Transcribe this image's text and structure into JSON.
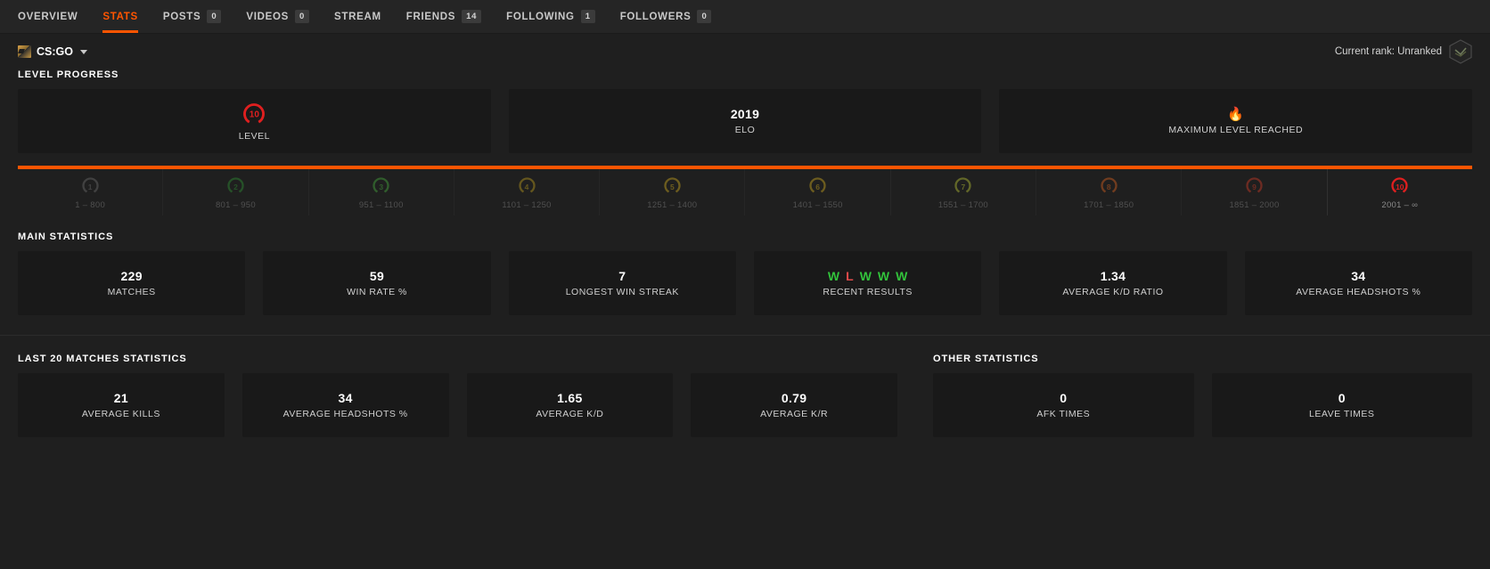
{
  "nav": {
    "items": [
      {
        "label": "OVERVIEW",
        "badge": null,
        "active": false
      },
      {
        "label": "STATS",
        "badge": null,
        "active": true
      },
      {
        "label": "POSTS",
        "badge": "0",
        "active": false
      },
      {
        "label": "VIDEOS",
        "badge": "0",
        "active": false
      },
      {
        "label": "STREAM",
        "badge": null,
        "active": false
      },
      {
        "label": "FRIENDS",
        "badge": "14",
        "active": false
      },
      {
        "label": "FOLLOWING",
        "badge": "1",
        "active": false
      },
      {
        "label": "FOLLOWERS",
        "badge": "0",
        "active": false
      }
    ]
  },
  "gamebar": {
    "game": "CS:GO",
    "rank_text": "Current rank: Unranked"
  },
  "level_progress": {
    "title": "LEVEL PROGRESS",
    "cards": [
      {
        "value": "10",
        "label": "LEVEL",
        "kind": "level-badge"
      },
      {
        "value": "2019",
        "label": "ELO",
        "kind": "text"
      },
      {
        "value": "🔥",
        "label": "MAXIMUM LEVEL REACHED",
        "kind": "flame"
      }
    ],
    "progress_percent": 100,
    "ticks": [
      {
        "level": "1",
        "range": "1 – 800",
        "color": "#6b6b6b",
        "dim": true
      },
      {
        "level": "2",
        "range": "801 – 950",
        "color": "#2f8f34",
        "dim": true
      },
      {
        "level": "3",
        "range": "951 – 1100",
        "color": "#46a83c",
        "dim": true
      },
      {
        "level": "4",
        "range": "1101 – 1250",
        "color": "#b99a1d",
        "dim": true
      },
      {
        "level": "5",
        "range": "1251 – 1400",
        "color": "#c9a61f",
        "dim": true
      },
      {
        "level": "6",
        "range": "1401 – 1550",
        "color": "#c9a61f",
        "dim": true
      },
      {
        "level": "7",
        "range": "1551 – 1700",
        "color": "#b5bf33",
        "dim": true
      },
      {
        "level": "8",
        "range": "1701 – 1850",
        "color": "#d4611f",
        "dim": true
      },
      {
        "level": "9",
        "range": "1851 – 2000",
        "color": "#cc3b26",
        "dim": true
      },
      {
        "level": "10",
        "range": "2001 – ∞",
        "color": "#e01f1f",
        "dim": false
      }
    ]
  },
  "main_statistics": {
    "title": "MAIN STATISTICS",
    "cards": [
      {
        "value": "229",
        "label": "MATCHES",
        "kind": "text"
      },
      {
        "value": "59",
        "label": "WIN RATE %",
        "kind": "text"
      },
      {
        "value": "7",
        "label": "LONGEST WIN STREAK",
        "kind": "text"
      },
      {
        "value": "",
        "label": "RECENT RESULTS",
        "kind": "results",
        "results": [
          "W",
          "L",
          "W",
          "W",
          "W"
        ]
      },
      {
        "value": "1.34",
        "label": "AVERAGE K/D RATIO",
        "kind": "text"
      },
      {
        "value": "34",
        "label": "AVERAGE HEADSHOTS %",
        "kind": "text"
      }
    ]
  },
  "last_20": {
    "title": "LAST 20 MATCHES STATISTICS",
    "cards": [
      {
        "value": "21",
        "label": "AVERAGE KILLS"
      },
      {
        "value": "34",
        "label": "AVERAGE HEADSHOTS %"
      },
      {
        "value": "1.65",
        "label": "AVERAGE K/D"
      },
      {
        "value": "0.79",
        "label": "AVERAGE K/R"
      }
    ]
  },
  "other_statistics": {
    "title": "OTHER STATISTICS",
    "cards": [
      {
        "value": "0",
        "label": "AFK TIMES"
      },
      {
        "value": "0",
        "label": "LEAVE TIMES"
      }
    ]
  },
  "colors": {
    "accent": "#ff5500",
    "background": "#1f1f1f",
    "card": "#191919",
    "navbar": "#252525",
    "win": "#32c23b",
    "loss": "#e04a4a"
  }
}
